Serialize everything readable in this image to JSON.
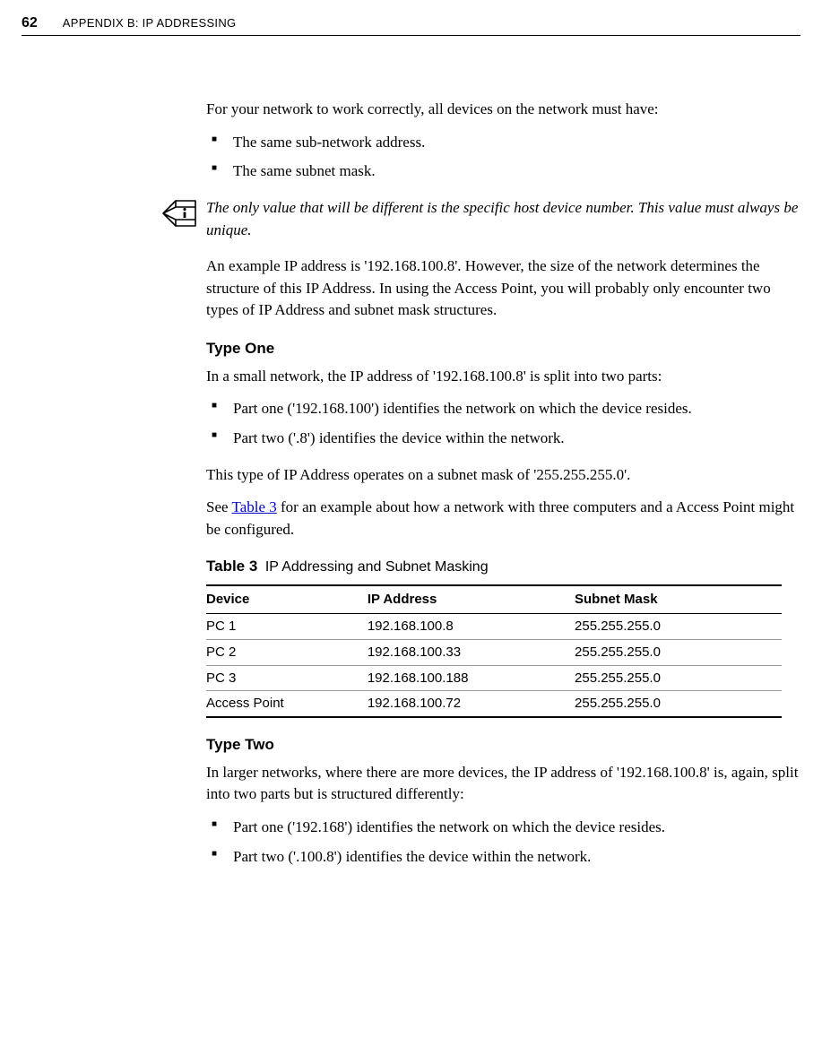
{
  "page_number": "62",
  "header_title": "APPENDIX B: IP ADDRESSING",
  "intro_para": "For your network to work correctly, all devices on the network must have:",
  "intro_bullets": [
    "The same sub-network address.",
    "The same subnet mask."
  ],
  "info_note": "The only value that will be different is the specific host device number. This value must always be unique.",
  "example_para": "An example IP address is '192.168.100.8'. However, the size of the network determines the structure of this IP Address. In using the Access Point, you will probably only encounter two types of IP Address and subnet mask structures.",
  "type_one": {
    "heading": "Type One",
    "intro": "In a small network, the IP address of '192.168.100.8' is split into two parts:",
    "bullets": [
      "Part one ('192.168.100') identifies the network on which the device resides.",
      "Part two ('.8') identifies the device within the network."
    ],
    "mask_para": "This type of IP Address operates on a subnet mask of '255.255.255.0'.",
    "see_pre": "See ",
    "see_link": "Table 3",
    "see_post": " for an example about how a network with three computers and a Access Point might be configured."
  },
  "table": {
    "label": "Table 3",
    "title": "IP Addressing and Subnet Masking",
    "headers": [
      "Device",
      "IP Address",
      "Subnet Mask"
    ],
    "rows": [
      [
        "PC 1",
        "192.168.100.8",
        "255.255.255.0"
      ],
      [
        "PC 2",
        "192.168.100.33",
        "255.255.255.0"
      ],
      [
        "PC 3",
        "192.168.100.188",
        "255.255.255.0"
      ],
      [
        "Access Point",
        "192.168.100.72",
        "255.255.255.0"
      ]
    ]
  },
  "type_two": {
    "heading": "Type Two",
    "intro": "In larger networks, where there are more devices, the IP address of '192.168.100.8' is, again, split into two parts but is structured differently:",
    "bullets": [
      "Part one ('192.168') identifies the network on which the device resides.",
      "Part two ('.100.8') identifies the device within the network."
    ]
  }
}
